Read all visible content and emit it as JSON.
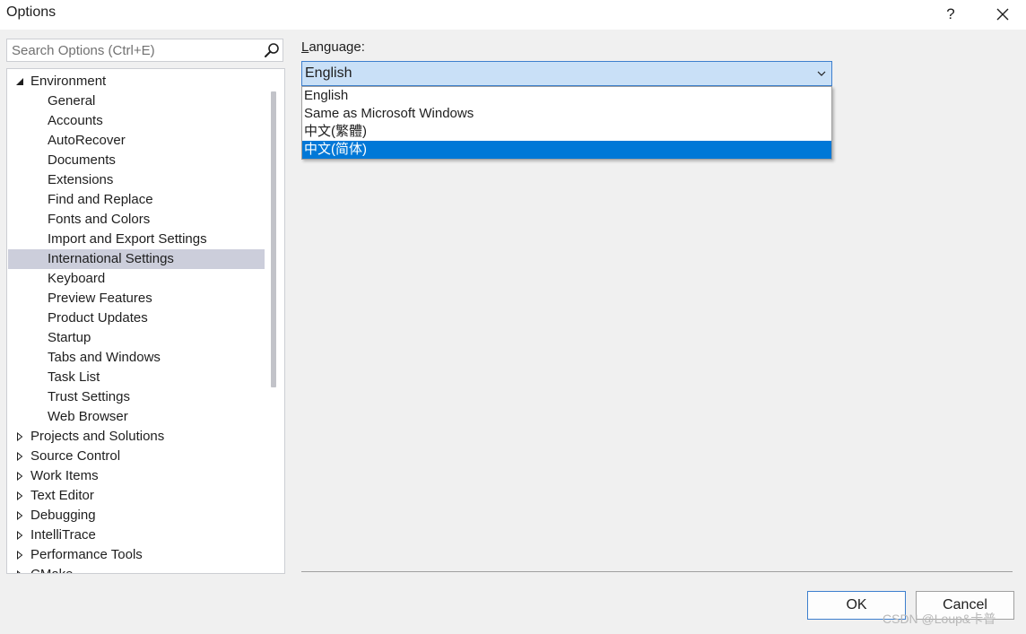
{
  "window": {
    "title": "Options",
    "help_label": "?",
    "close_label": "✕"
  },
  "search": {
    "placeholder": "Search Options (Ctrl+E)"
  },
  "tree": {
    "environment": {
      "label": "Environment",
      "expanded": true,
      "children": [
        "General",
        "Accounts",
        "AutoRecover",
        "Documents",
        "Extensions",
        "Find and Replace",
        "Fonts and Colors",
        "Import and Export Settings",
        "International Settings",
        "Keyboard",
        "Preview Features",
        "Product Updates",
        "Startup",
        "Tabs and Windows",
        "Task List",
        "Trust Settings",
        "Web Browser"
      ],
      "selected": "International Settings"
    },
    "collapsed": [
      "Projects and Solutions",
      "Source Control",
      "Work Items",
      "Text Editor",
      "Debugging",
      "IntelliTrace",
      "Performance Tools",
      "CMake"
    ]
  },
  "language": {
    "label_accel": "L",
    "label_rest": "anguage:",
    "selected_value": "English",
    "options": [
      "English",
      "Same as Microsoft Windows",
      "中文(繁體)",
      "中文(简体)"
    ],
    "highlighted_option": "中文(简体)"
  },
  "buttons": {
    "ok": "OK",
    "cancel": "Cancel"
  },
  "watermark": "CSDN @Loup&卡普",
  "colors": {
    "selection_bg": "#cccedb",
    "highlight_bg": "#0078d7",
    "combo_bg": "#c9e0f7",
    "accent_border": "#3d7fce"
  }
}
